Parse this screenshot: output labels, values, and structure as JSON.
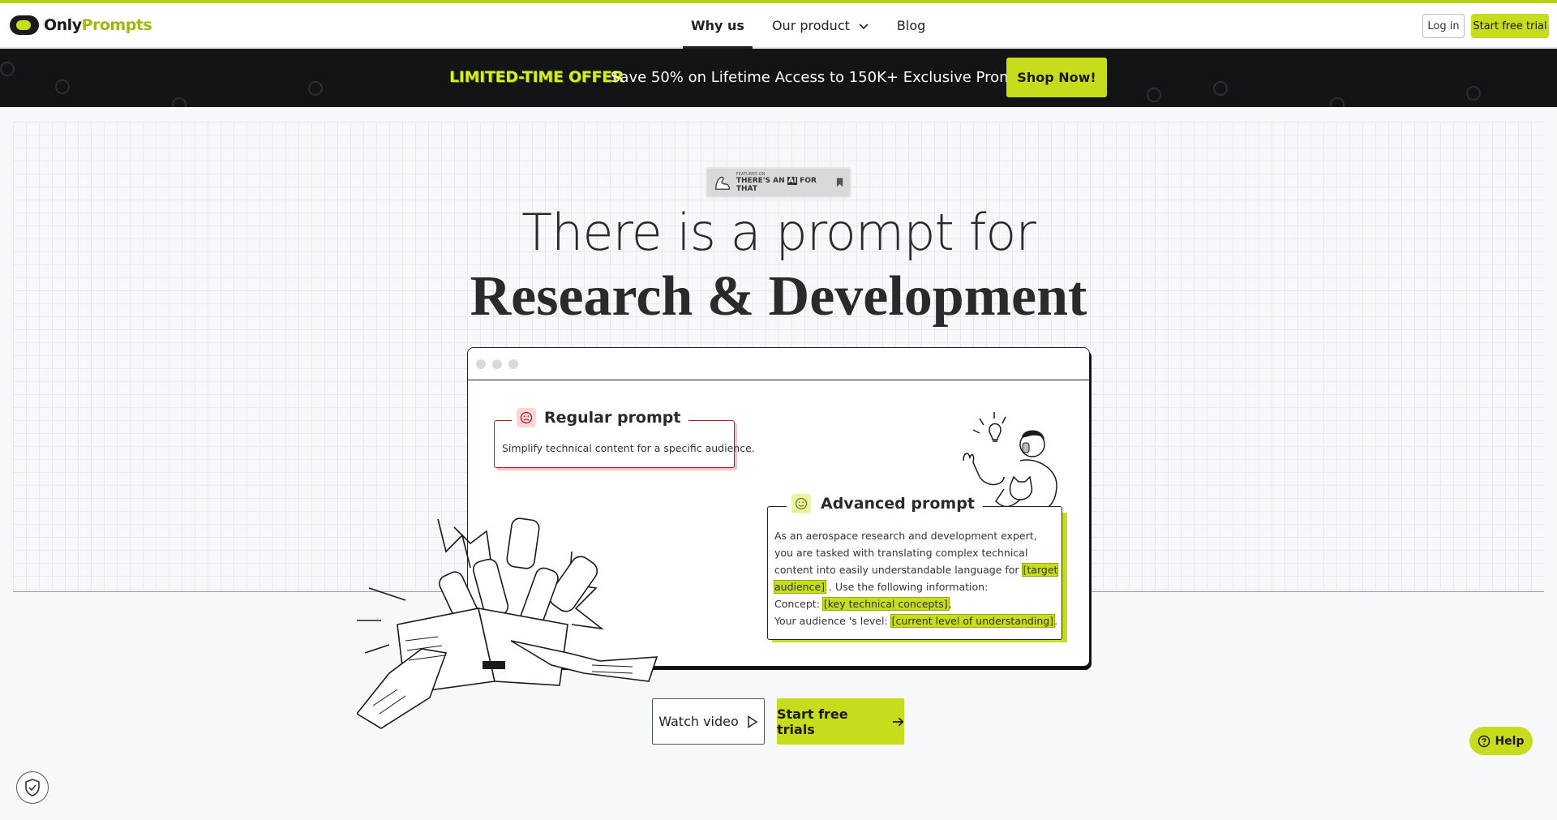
{
  "header": {
    "logo": {
      "part1": "Only",
      "part2": "Prompts"
    },
    "nav": [
      {
        "label": "Why us",
        "active": true
      },
      {
        "label": "Our product",
        "has_dropdown": true
      },
      {
        "label": "Blog"
      }
    ],
    "login_label": "Log in",
    "trial_label": "Start free trial"
  },
  "promo": {
    "offer_label": "LIMITED-TIME OFFER",
    "text": "Save 50% on Lifetime Access to 150K+ Exclusive Prompts!",
    "button_label": "Shop Now!"
  },
  "badge": {
    "small": "FEATURED ON",
    "pre": "THERE'S AN",
    "ai": "AI",
    "post": "FOR THAT"
  },
  "hero": {
    "line1": "There is a prompt for",
    "line2": "Research & Development"
  },
  "regular_prompt": {
    "title": "Regular prompt",
    "text": "Simplify technical content for a specific audience."
  },
  "advanced_prompt": {
    "title": "Advanced prompt",
    "text_1": "As an aerospace research and development expert, you are tasked with translating complex technical content into easily understandable language for ",
    "hl_1": "[target audience]",
    "text_2": " . Use the following information:",
    "concept_label": "Concept: ",
    "hl_2": "[key technical concepts]",
    "concept_end": ",",
    "level_label": "Your audience 's level: ",
    "hl_3": "[current level of understanding]",
    "level_end": "."
  },
  "cta": {
    "watch_label": "Watch video",
    "start_label": "Start free trials"
  },
  "help_label": "Help",
  "colors": {
    "accent": "#c8dc1e",
    "dark": "#121416",
    "regular_border": "#a3202a"
  }
}
